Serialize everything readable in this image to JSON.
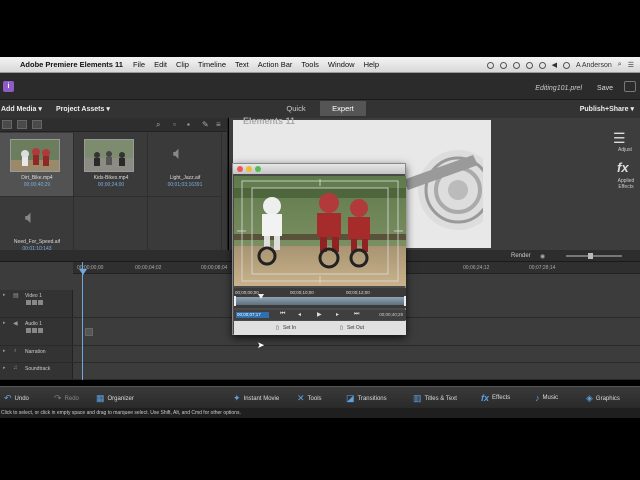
{
  "menubar": {
    "app_name": "Adobe Premiere Elements 11",
    "items": [
      "File",
      "Edit",
      "Clip",
      "Timeline",
      "Text",
      "Action Bar",
      "Tools",
      "Window",
      "Help"
    ],
    "user": "A Anderson"
  },
  "titlebar": {
    "filename": "Editing101.prel",
    "save_label": "Save"
  },
  "moderow": {
    "add_media": "Add Media ▾",
    "project_assets": "Project Assets ▾",
    "quick": "Quick",
    "expert": "Expert",
    "publish_share": "Publish+Share ▾"
  },
  "assets": [
    {
      "name": "Dirt_Bike.mp4",
      "duration": "00;00;40;29",
      "kind": "video",
      "selected": true
    },
    {
      "name": "Kids-Bikes.mp4",
      "duration": "00;00;24;00",
      "kind": "video",
      "selected": false
    },
    {
      "name": "Light_Jazz.aif",
      "duration": "00;01;03;16391",
      "kind": "audio",
      "selected": false
    },
    {
      "name": "Need_For_Speed.aif",
      "duration": "00;01;10;143",
      "kind": "audio",
      "selected": false
    }
  ],
  "monitor": {
    "title": "Elements 11"
  },
  "ruler": {
    "render": "Render",
    "timecodes": [
      "00;00;00;00",
      "00;00;04;02",
      "00;00;08;04",
      "00;06;24;12",
      "00;07;28;14"
    ]
  },
  "tracks": [
    {
      "name": "Video 1",
      "icon": "film-icon"
    },
    {
      "name": "Audio 1",
      "icon": "speaker-icon"
    },
    {
      "name": "Narration",
      "icon": "mic-icon"
    },
    {
      "name": "Soundtrack",
      "icon": "music-note-icon"
    }
  ],
  "bottombar": {
    "undo": "Undo",
    "redo": "Redo",
    "organizer": "Organizer",
    "instant_movie": "Instant Movie",
    "tools": "Tools",
    "transitions": "Transitions",
    "titles_text": "Titles & Text",
    "effects": "Effects",
    "music": "Music",
    "graphics": "Graphics"
  },
  "right_panel": {
    "adjust": "Adjust",
    "applied_effects": "Applied Effects"
  },
  "status": "Click to select, or click in empty space and drag to marquee select. Use Shift, Alt, and Cmd for other options.",
  "trim": {
    "t_left": "00;00;00;00",
    "t_mid": "00;00;10;00",
    "t_mid2": "00;00;12;00",
    "current": "00;00;07;17",
    "end": "00;00;40;29",
    "set_in": "Set In",
    "set_out": "Set Out"
  },
  "colors": {
    "accent": "#5ea0e0",
    "logo": "#8e5bc7",
    "scrub": "#6f8494"
  }
}
